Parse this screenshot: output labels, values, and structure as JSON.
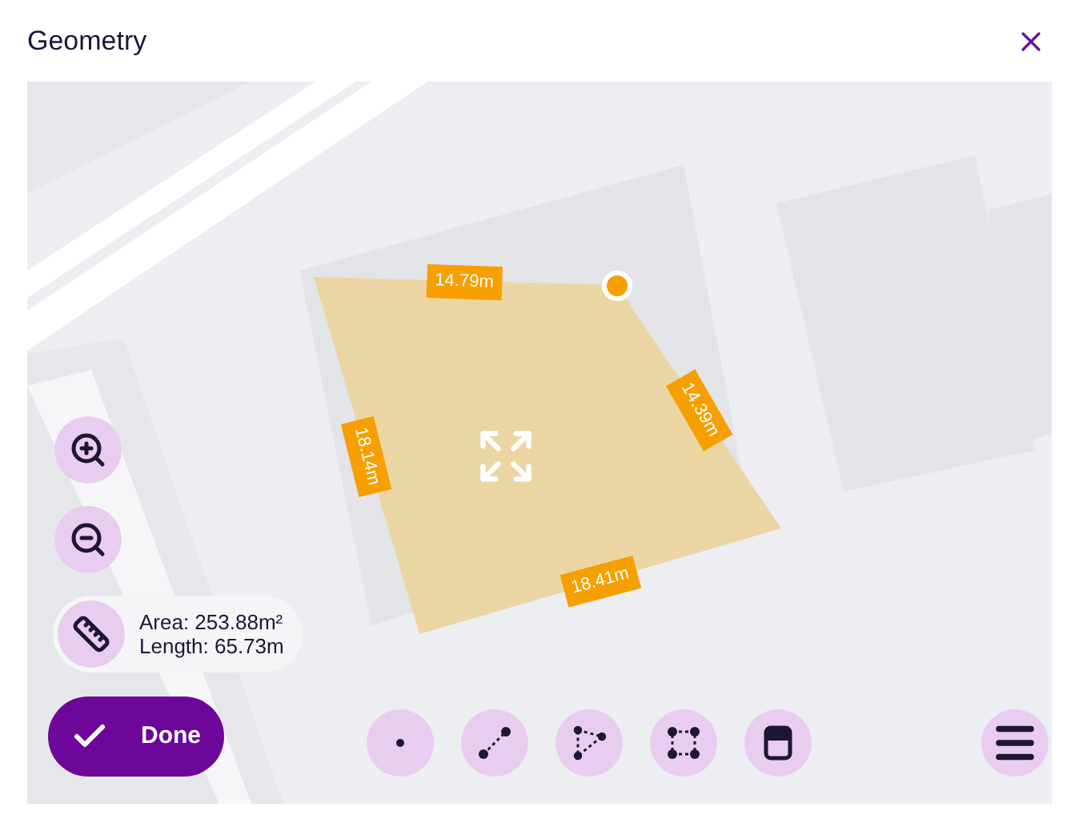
{
  "window": {
    "title": "Geometry"
  },
  "edges": [
    {
      "label": "14.79m"
    },
    {
      "label": "14.39m"
    },
    {
      "label": "18.41m"
    },
    {
      "label": "18.14m"
    }
  ],
  "measurement": {
    "area": "Area: 253.88m²",
    "length": "Length: 65.73m"
  },
  "done_button": {
    "label": "Done"
  },
  "tools": [
    {
      "kind": "point"
    },
    {
      "kind": "line"
    },
    {
      "kind": "triangle"
    },
    {
      "kind": "rectangle"
    },
    {
      "kind": "layer"
    },
    {
      "kind": "menu"
    }
  ]
}
